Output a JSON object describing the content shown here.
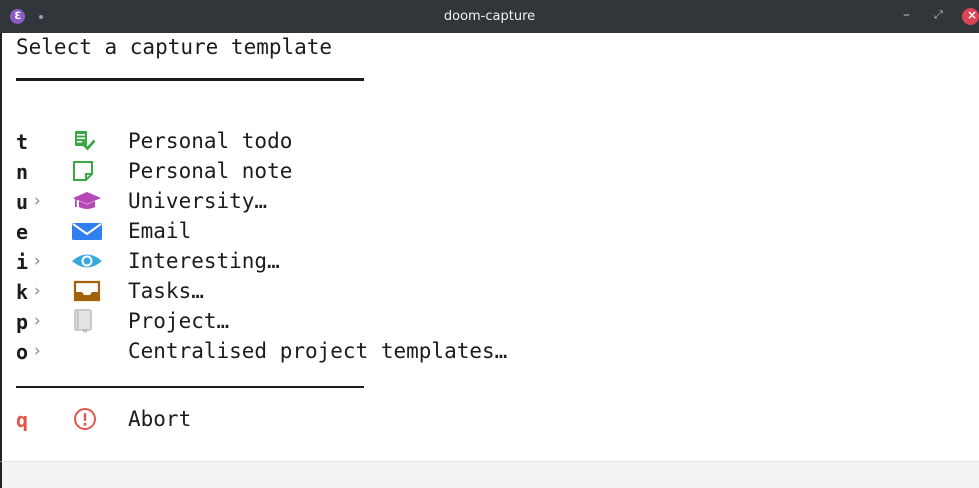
{
  "window": {
    "title": "doom-capture",
    "app_icon_glyph": "ℇ",
    "minimize_glyph": "–",
    "maximize_glyph": "⤢",
    "close_glyph": "×"
  },
  "menu": {
    "heading": "Select a capture template",
    "items": [
      {
        "key": "t",
        "has_submenu": false,
        "icon": "todo-checklist-icon",
        "color": "#3aa945",
        "label": "Personal todo"
      },
      {
        "key": "n",
        "has_submenu": false,
        "icon": "sticky-note-icon",
        "color": "#3aa945",
        "label": "Personal note"
      },
      {
        "key": "u",
        "has_submenu": true,
        "icon": "graduation-cap-icon",
        "color": "#b548b6",
        "label": "University…"
      },
      {
        "key": "e",
        "has_submenu": false,
        "icon": "envelope-icon",
        "color": "#2f7ff0",
        "label": "Email"
      },
      {
        "key": "i",
        "has_submenu": true,
        "icon": "eye-icon",
        "color": "#3aa8e0",
        "label": "Interesting…"
      },
      {
        "key": "k",
        "has_submenu": true,
        "icon": "inbox-tray-icon",
        "color": "#a0620a",
        "label": "Tasks…"
      },
      {
        "key": "p",
        "has_submenu": true,
        "icon": "notebook-icon",
        "color": "#bcbcbc",
        "label": "Project…"
      },
      {
        "key": "o",
        "has_submenu": true,
        "icon": "",
        "color": "",
        "label": "Centralised project templates…"
      }
    ],
    "submenu_marker": "›",
    "abort": {
      "key": "q",
      "icon": "exclamation-circle-icon",
      "color": "#e45649",
      "label": "Abort"
    }
  }
}
